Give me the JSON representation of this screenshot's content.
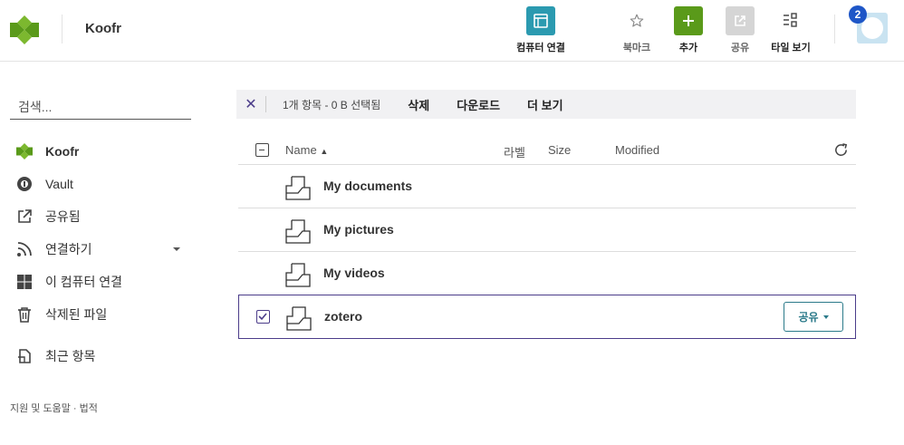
{
  "header": {
    "app_title": "Koofr",
    "toolbar": [
      {
        "label": "컴퓨터 연결",
        "icon": "computer-window-icon",
        "color": "#2b9ab0",
        "label_color": "#222"
      },
      {
        "label": "북마크",
        "icon": "star-icon",
        "color": "#ffffff",
        "label_color": "#666"
      },
      {
        "label": "추가",
        "icon": "plus-icon",
        "color": "#5a9a1a",
        "label_color": "#222"
      },
      {
        "label": "공유",
        "icon": "share-icon",
        "color": "#d5d5d5",
        "label_color": "#666"
      },
      {
        "label": "타일 보기",
        "icon": "tile-view-icon",
        "color": "#ffffff",
        "label_color": "#222"
      }
    ],
    "notification_count": "2"
  },
  "sidebar": {
    "search_placeholder": "검색...",
    "items": [
      {
        "label": "Koofr",
        "icon": "koofr-logo-icon",
        "active": true
      },
      {
        "label": "Vault",
        "icon": "vault-icon"
      },
      {
        "label": "공유됨",
        "icon": "external-link-icon"
      },
      {
        "label": "연결하기",
        "icon": "rss-icon"
      },
      {
        "label": "이 컴퓨터 연결",
        "icon": "windows-icon"
      },
      {
        "label": "삭제된 파일",
        "icon": "trash-icon"
      },
      {
        "label": "최근 항목",
        "icon": "recent-icon"
      }
    ],
    "footer": "지원 및 도움말 · 법적"
  },
  "selection_bar": {
    "count_text": "1개 항목 - 0 B 선택됨",
    "actions": [
      "삭제",
      "다운로드",
      "더 보기"
    ]
  },
  "table": {
    "columns": {
      "name": "Name",
      "label": "라벨",
      "size": "Size",
      "modified": "Modified"
    },
    "rows": [
      {
        "name": "My documents",
        "selected": false
      },
      {
        "name": "My pictures",
        "selected": false
      },
      {
        "name": "My videos",
        "selected": false
      },
      {
        "name": "zotero",
        "selected": true,
        "share_label": "공유"
      }
    ]
  },
  "colors": {
    "accent": "#4b3c8a",
    "brand_green": "#5a9a1a",
    "teal": "#2b7a8a"
  }
}
